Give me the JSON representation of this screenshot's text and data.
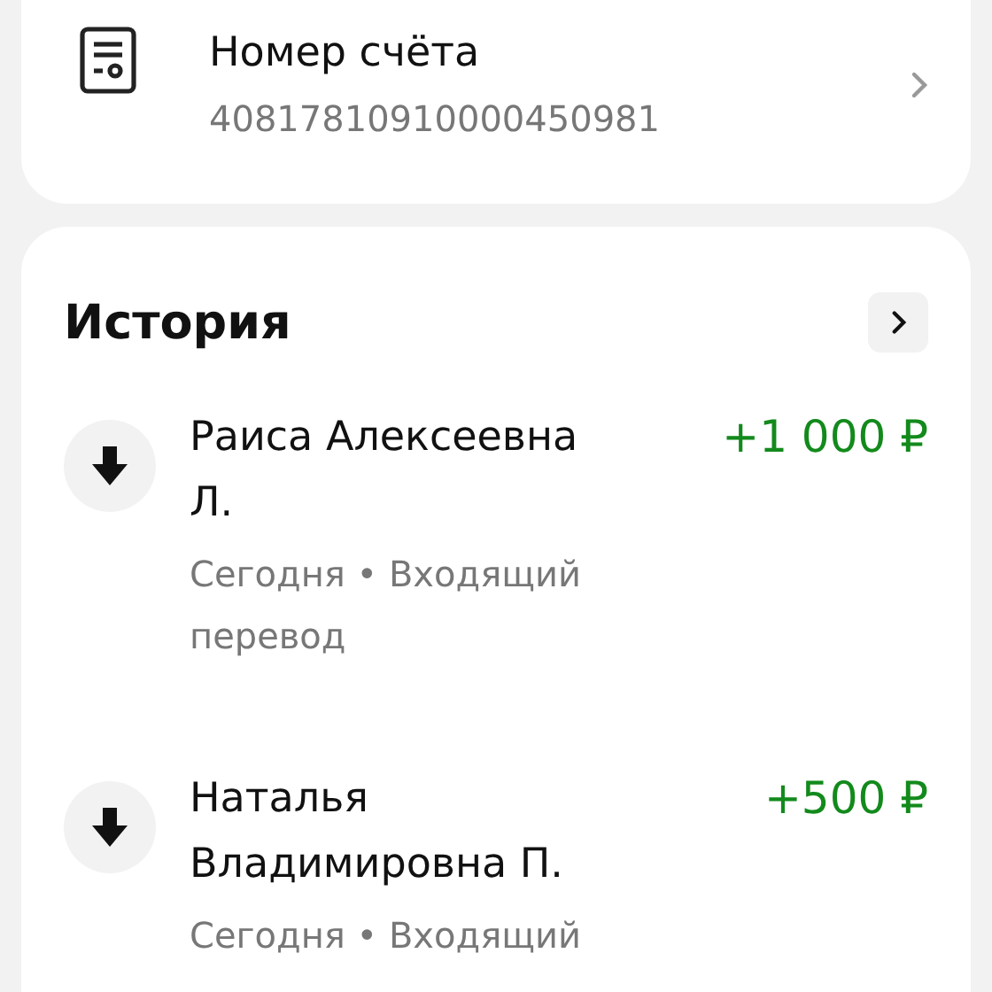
{
  "account": {
    "title": "Номер счёта",
    "number": "40817810910000450981"
  },
  "history": {
    "title": "История",
    "items": [
      {
        "kind": "incoming",
        "name": "Раиса Алексеевна Л.",
        "subtitle": "Сегодня • Входящий перевод",
        "amount": "+1 000 ₽"
      },
      {
        "kind": "incoming",
        "name": "Наталья Владимировна П.",
        "subtitle": "Сегодня • Входящий",
        "amount": "+500 ₽"
      }
    ]
  }
}
